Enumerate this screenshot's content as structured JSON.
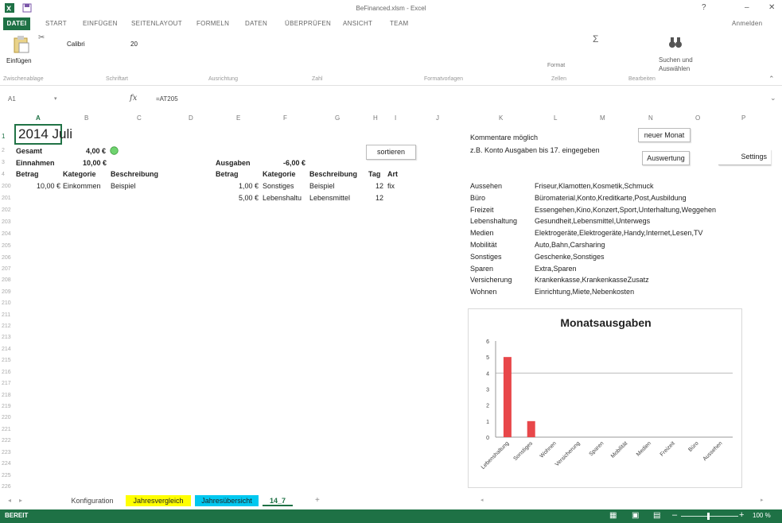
{
  "window": {
    "title": "BeFinanced.xlsm - Excel",
    "help": "?",
    "minimize": "–",
    "close": "✕",
    "signin": "Anmelden"
  },
  "ribbon_tabs": [
    "DATEI",
    "START",
    "EINFÜGEN",
    "SEITENLAYOUT",
    "FORMELN",
    "DATEN",
    "ÜBERPRÜFEN",
    "ANSICHT",
    "TEAM"
  ],
  "ribbon": {
    "paste_label": "Einfügen",
    "font_name": "Calibri",
    "font_size": "20",
    "format_label": "Format",
    "find_label_1": "Suchen und",
    "find_label_2": "Auswählen",
    "groups": [
      "Zwischenablage",
      "Schriftart",
      "Ausrichtung",
      "Zahl",
      "Formatvorlagen",
      "Zellen",
      "Bearbeiten"
    ]
  },
  "formula_bar": {
    "name_box": "A1",
    "fx": "fx",
    "formula": "=AT205"
  },
  "columns": [
    "A",
    "B",
    "C",
    "D",
    "E",
    "F",
    "G",
    "H",
    "I",
    "J",
    "K",
    "L",
    "M",
    "N",
    "O",
    "P"
  ],
  "rows": [
    "1",
    "2",
    "3",
    "4",
    "200",
    "201",
    "202",
    "203",
    "204",
    "205",
    "206",
    "207",
    "208",
    "209",
    "210",
    "211",
    "212",
    "213",
    "214",
    "215",
    "216",
    "217",
    "218",
    "219",
    "220",
    "221",
    "222",
    "223",
    "224",
    "225",
    "226"
  ],
  "sheet": {
    "title": "2014 Juli",
    "gesamt_label": "Gesamt",
    "gesamt_value": "4,00 €",
    "einnahmen_label": "Einnahmen",
    "einnahmen_value": "10,00 €",
    "ausgaben_label": "Ausgaben",
    "ausgaben_value": "-6,00 €",
    "sortieren": "sortieren",
    "headers_left": [
      "Betrag",
      "Kategorie",
      "Beschreibung"
    ],
    "headers_right": [
      "Betrag",
      "Kategorie",
      "Beschreibung",
      "Tag",
      "Art"
    ],
    "income_rows": [
      {
        "betrag": "10,00 €",
        "kategorie": "Einkommen",
        "beschreibung": "Beispiel"
      }
    ],
    "expense_rows": [
      {
        "betrag": "1,00 €",
        "kategorie": "Sonstiges",
        "beschreibung": "Beispiel",
        "tag": "12",
        "art": "fix"
      },
      {
        "betrag": "5,00 €",
        "kategorie": "Lebenshaltu",
        "beschreibung": "Lebensmittel",
        "tag": "12",
        "art": ""
      }
    ],
    "kommentare": "Kommentare möglich",
    "beispiel_kommentar": "z.B. Konto Ausgaben bis 17. eingegeben",
    "btn_neuer_monat": "neuer Monat",
    "btn_auswertung": "Auswertung",
    "btn_settings": "Settings",
    "categories": [
      {
        "name": "Aussehen",
        "items": "Friseur,Klamotten,Kosmetik,Schmuck"
      },
      {
        "name": "Büro",
        "items": "Büromaterial,Konto,Kreditkarte,Post,Ausbildung"
      },
      {
        "name": "Freizeit",
        "items": "Essengehen,Kino,Konzert,Sport,Unterhaltung,Weggehen"
      },
      {
        "name": "Lebenshaltung",
        "items": "Gesundheit,Lebensmittel,Unterwegs"
      },
      {
        "name": "Medien",
        "items": "Elektrogeräte,Elektrogeräte,Handy,Internet,Lesen,TV"
      },
      {
        "name": "Mobilität",
        "items": "Auto,Bahn,Carsharing"
      },
      {
        "name": "Sonstiges",
        "items": "Geschenke,Sonstiges"
      },
      {
        "name": "Sparen",
        "items": "Extra,Sparen"
      },
      {
        "name": "Versicherung",
        "items": "Krankenkasse,KrankenkasseZusatz"
      },
      {
        "name": "Wohnen",
        "items": "Einrichtung,Miete,Nebenkosten"
      }
    ]
  },
  "chart_data": {
    "type": "bar",
    "title": "Monatsausgaben",
    "categories": [
      "Lebenshaltung",
      "Sonstiges",
      "Wohnen",
      "Versicherung",
      "Sparen",
      "Mobilität",
      "Medien",
      "Freizeit",
      "Büro",
      "Aussehen"
    ],
    "values": [
      5,
      1,
      0,
      0,
      0,
      0,
      0,
      0,
      0,
      0
    ],
    "ylim": [
      0,
      6
    ],
    "yticks": [
      "0",
      "1",
      "2",
      "3",
      "4",
      "5",
      "6"
    ],
    "bar_color": "#e8474a",
    "grid": true
  },
  "sheet_tabs": [
    {
      "label": "Konfiguration",
      "color": ""
    },
    {
      "label": "Jahresvergleich",
      "color": "#ffff00"
    },
    {
      "label": "Jahresübersicht",
      "color": "#00c8f0"
    },
    {
      "label": "14_7",
      "color": ""
    }
  ],
  "status": {
    "ready": "BEREIT",
    "zoom": "100 %"
  },
  "colors": {
    "excel_green": "#1e7145",
    "indicator_green": "#6fd36f"
  }
}
